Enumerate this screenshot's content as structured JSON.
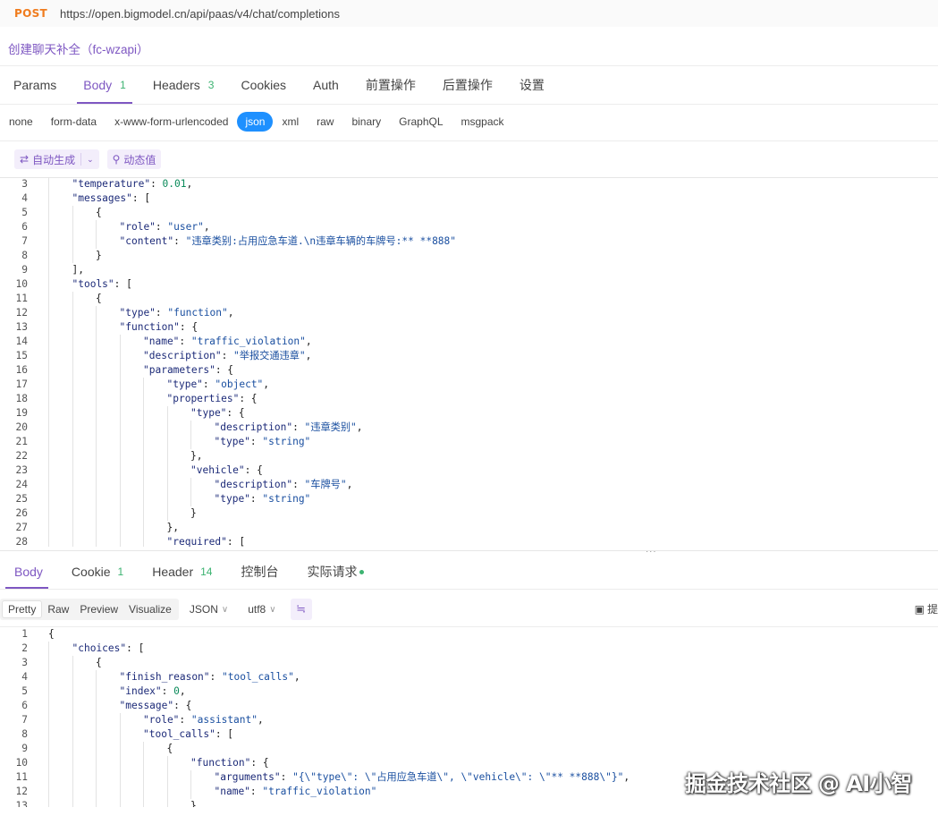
{
  "request": {
    "method": "POST",
    "url": "https://open.bigmodel.cn/api/paas/v4/chat/completions",
    "name": "创建聊天补全（fc-wzapi）"
  },
  "request_tabs": [
    {
      "label": "Params",
      "count": ""
    },
    {
      "label": "Body",
      "count": "1"
    },
    {
      "label": "Headers",
      "count": "3"
    },
    {
      "label": "Cookies",
      "count": ""
    },
    {
      "label": "Auth",
      "count": ""
    },
    {
      "label": "前置操作",
      "count": ""
    },
    {
      "label": "后置操作",
      "count": ""
    },
    {
      "label": "设置",
      "count": ""
    }
  ],
  "body_types": [
    "none",
    "form-data",
    "x-www-form-urlencoded",
    "json",
    "xml",
    "raw",
    "binary",
    "GraphQL",
    "msgpack"
  ],
  "body_type_selected": "json",
  "toolbar": {
    "auto_generate": "自动生成",
    "auto_generate_icon": "swap-icon",
    "dynamic_value": "动态值",
    "dynamic_value_icon": "magic-wand-icon"
  },
  "request_body_lines": [
    {
      "n": "3",
      "indent": 1,
      "text": "\"temperature\": 0.01,"
    },
    {
      "n": "4",
      "indent": 1,
      "text": "\"messages\": ["
    },
    {
      "n": "5",
      "indent": 2,
      "text": "{"
    },
    {
      "n": "6",
      "indent": 3,
      "text": "\"role\": \"user\","
    },
    {
      "n": "7",
      "indent": 3,
      "text": "\"content\": \"违章类别:占用应急车道.\\n违章车辆的车牌号:** **888\""
    },
    {
      "n": "8",
      "indent": 2,
      "text": "}"
    },
    {
      "n": "9",
      "indent": 1,
      "text": "],"
    },
    {
      "n": "10",
      "indent": 1,
      "text": "\"tools\": ["
    },
    {
      "n": "11",
      "indent": 2,
      "text": "{"
    },
    {
      "n": "12",
      "indent": 3,
      "text": "\"type\": \"function\","
    },
    {
      "n": "13",
      "indent": 3,
      "text": "\"function\": {"
    },
    {
      "n": "14",
      "indent": 4,
      "text": "\"name\": \"traffic_violation\","
    },
    {
      "n": "15",
      "indent": 4,
      "text": "\"description\": \"举报交通违章\","
    },
    {
      "n": "16",
      "indent": 4,
      "text": "\"parameters\": {"
    },
    {
      "n": "17",
      "indent": 5,
      "text": "\"type\": \"object\","
    },
    {
      "n": "18",
      "indent": 5,
      "text": "\"properties\": {"
    },
    {
      "n": "19",
      "indent": 6,
      "text": "\"type\": {"
    },
    {
      "n": "20",
      "indent": 7,
      "text": "\"description\": \"违章类别\","
    },
    {
      "n": "21",
      "indent": 7,
      "text": "\"type\": \"string\""
    },
    {
      "n": "22",
      "indent": 6,
      "text": "},"
    },
    {
      "n": "23",
      "indent": 6,
      "text": "\"vehicle\": {"
    },
    {
      "n": "24",
      "indent": 7,
      "text": "\"description\": \"车牌号\","
    },
    {
      "n": "25",
      "indent": 7,
      "text": "\"type\": \"string\""
    },
    {
      "n": "26",
      "indent": 6,
      "text": "}"
    },
    {
      "n": "27",
      "indent": 5,
      "text": "},"
    },
    {
      "n": "28",
      "indent": 5,
      "text": "\"required\": ["
    }
  ],
  "response_tabs": [
    {
      "label": "Body",
      "count": ""
    },
    {
      "label": "Cookie",
      "count": "1"
    },
    {
      "label": "Header",
      "count": "14"
    },
    {
      "label": "控制台",
      "count": ""
    },
    {
      "label": "实际请求",
      "count": ""
    }
  ],
  "response_toolbar": {
    "views": [
      "Pretty",
      "Raw",
      "Preview",
      "Visualize"
    ],
    "view_selected": "Pretty",
    "format": "JSON",
    "encoding": "utf8",
    "wrap_icon": "wrap-lines-icon",
    "save_label": "提",
    "save_icon": "save-icon"
  },
  "response_body_lines": [
    {
      "n": "1",
      "indent": 0,
      "text": "{"
    },
    {
      "n": "2",
      "indent": 1,
      "text": "\"choices\": ["
    },
    {
      "n": "3",
      "indent": 2,
      "text": "{"
    },
    {
      "n": "4",
      "indent": 3,
      "text": "\"finish_reason\": \"tool_calls\","
    },
    {
      "n": "5",
      "indent": 3,
      "text": "\"index\": 0,"
    },
    {
      "n": "6",
      "indent": 3,
      "text": "\"message\": {"
    },
    {
      "n": "7",
      "indent": 4,
      "text": "\"role\": \"assistant\","
    },
    {
      "n": "8",
      "indent": 4,
      "text": "\"tool_calls\": ["
    },
    {
      "n": "9",
      "indent": 5,
      "text": "{"
    },
    {
      "n": "10",
      "indent": 6,
      "text": "\"function\": {"
    },
    {
      "n": "11",
      "indent": 7,
      "text": "\"arguments\": \"{\\\"type\\\": \\\"占用应急车道\\\", \\\"vehicle\\\": \\\"** **888\\\"}\","
    },
    {
      "n": "12",
      "indent": 7,
      "text": "\"name\": \"traffic_violation\""
    },
    {
      "n": "13",
      "indent": 6,
      "text": "}"
    }
  ],
  "watermark": "掘金技术社区 @ AI小智",
  "colors": {
    "accent": "#7e57c2",
    "method": "#f07c1e",
    "selected_pill": "#1e90ff",
    "count": "#3cb371"
  }
}
